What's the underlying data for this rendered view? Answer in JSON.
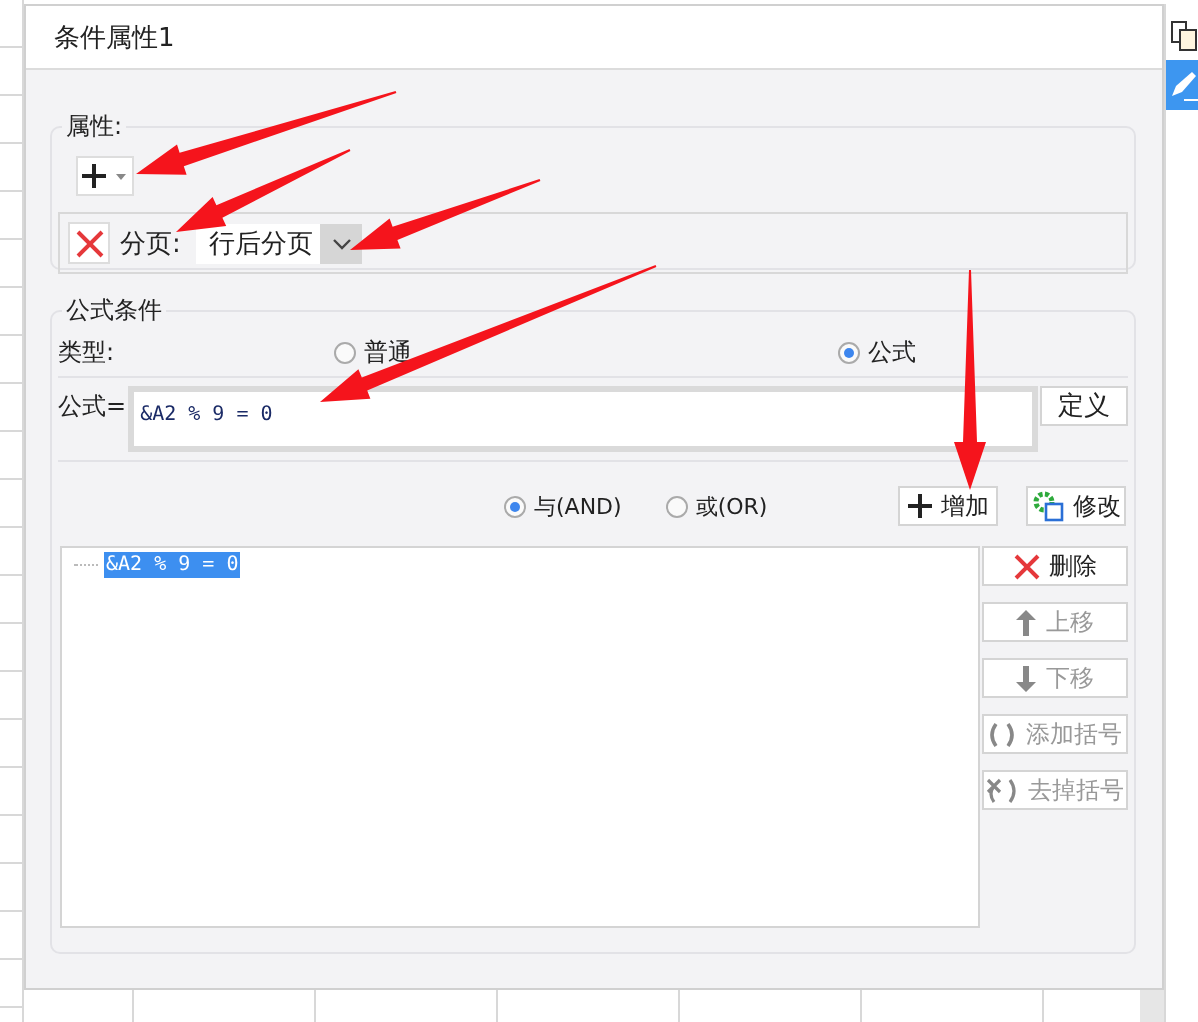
{
  "window": {
    "title": "条件属性1"
  },
  "side_toolbar": [
    {
      "selected": false
    },
    {
      "selected": true
    }
  ],
  "properties": {
    "label": "属性:",
    "rows": [
      {
        "label": "分页:",
        "value": "行后分页"
      }
    ]
  },
  "formula_condition": {
    "title": "公式条件",
    "type_label": "类型:",
    "types": [
      {
        "label": "普通",
        "selected": false
      },
      {
        "label": "公式",
        "selected": true
      }
    ],
    "formula_label": "公式=",
    "formula": "&A2 % 9 = 0",
    "define_button": "定义",
    "logic": [
      {
        "label": "与(AND)",
        "selected": true
      },
      {
        "label": "或(OR)",
        "selected": false
      }
    ],
    "add_button": "增加",
    "edit_button": "修改",
    "conditions": [
      {
        "text": "&A2 % 9 = 0",
        "selected": true
      }
    ],
    "actions": [
      {
        "kind": "delete",
        "label": "删除",
        "disabled": false
      },
      {
        "kind": "up",
        "label": "上移",
        "disabled": true
      },
      {
        "kind": "down",
        "label": "下移",
        "disabled": true
      },
      {
        "kind": "add_paren",
        "label": "添加括号",
        "disabled": true
      },
      {
        "kind": "remove_paren",
        "label": "去掉括号",
        "disabled": true
      }
    ]
  }
}
